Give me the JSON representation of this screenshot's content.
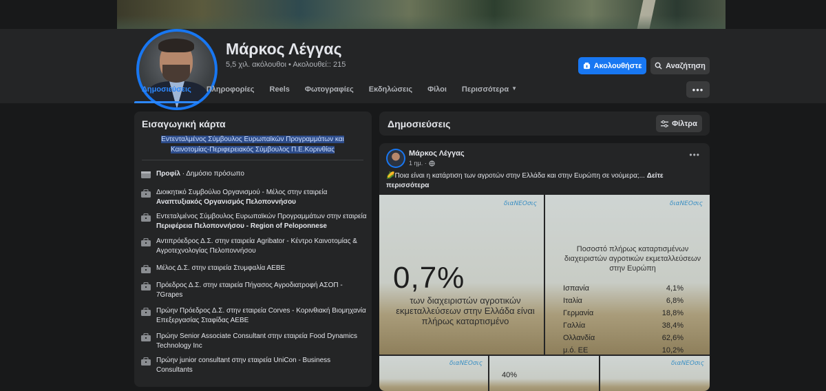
{
  "profile": {
    "name": "Μάρκος Λέγγας",
    "stats": "5,5 χιλ. ακόλουθοι • Ακολουθεί:: 215",
    "follow_label": "Ακολουθήστε",
    "search_label": "Αναζήτηση",
    "more_icon": "more-dots-icon"
  },
  "tabs": [
    {
      "label": "Δημοσιεύσεις",
      "active": true
    },
    {
      "label": "Πληροφορίες"
    },
    {
      "label": "Reels"
    },
    {
      "label": "Φωτογραφίες"
    },
    {
      "label": "Εκδηλώσεις"
    },
    {
      "label": "Φίλοι"
    },
    {
      "label": "Περισσότερα"
    }
  ],
  "intro": {
    "title": "Εισαγωγική κάρτα",
    "bio_line1": "Εντενταλμένος Σύμβουλος Ευρωπαϊκών Προγραμμάτων και",
    "bio_line2": "Καινοτομίας-Περιφερειακός Σύμβουλος Π.Ε.Κορινθίας",
    "items": [
      {
        "a": "",
        "b": "Προφίλ",
        "c": " · Δημόσιο πρόσωπο"
      },
      {
        "a": "Διοικητικό Συμβούλιο Οργανισμού - Μέλος στην εταιρεία ",
        "b": "Αναπτυξιακός Οργανισμός Πελοποννήσου",
        "c": ""
      },
      {
        "a": "Εντεταλμένος Σύμβουλος Ευρωπαϊκών Προγραμμάτων στην εταιρεία ",
        "b": "Περιφέρεια Πελοποννήσου - Region of Peloponnese",
        "c": ""
      },
      {
        "a": "Αντιπρόεδρος Δ.Σ. στην εταιρεία Agribator - Κέντρο Καινοτομίας & Αγροτεχνολογίας Πελοποννήσου",
        "b": "",
        "c": ""
      },
      {
        "a": "Μέλος Δ.Σ. στην εταιρεία Στυμφαλία ΑΕΒΕ",
        "b": "",
        "c": ""
      },
      {
        "a": "Πρόεδρος Δ.Σ. στην εταιρεία Πήγασος Αγροδιατροφή ΑΣΟΠ - 7Grapes",
        "b": "",
        "c": ""
      },
      {
        "a": "Πρώην Πρόεδρος Δ.Σ. στην εταιρεία Corves - Κορινθιακή Βιομηχανία Επεξεργασίας Σταφίδας ΑΕΒΕ",
        "b": "",
        "c": ""
      },
      {
        "a": "Πρώην Senior Associate Consultant στην εταιρεία Food Dynamics Technology Inc",
        "b": "",
        "c": ""
      },
      {
        "a": "Πρώην junior consultant στην εταιρεία UniCon - Business Consultants",
        "b": "",
        "c": ""
      }
    ]
  },
  "posts": {
    "title": "Δημοσιεύσεις",
    "filter_label": "Φίλτρα",
    "post": {
      "author": "Μάρκος Λέγγας",
      "time": "1 ημ. ·",
      "text": "🌽Ποια είναι η κατάρτιση των αγροτών στην Ελλάδα και στην Ευρώπη σε νούμερα;... ",
      "see_more": "Δείτε περισσότερα",
      "img1": {
        "logo": "διαΝΕΟσις",
        "big": "0,7%",
        "sub": "των διαχειριστών αγροτικών εκμεταλλεύσεων στην Ελλάδα είναι πλήρως καταρτισμένο"
      },
      "img2": {
        "logo": "διαΝΕΟσις",
        "title": "Ποσοστό πλήρως καταρτισμένων διαχειριστών αγροτικών εκμεταλλεύσεων στην Ευρώπη",
        "rows": [
          {
            "country": "Ισπανία",
            "value": "4,1%"
          },
          {
            "country": "Ιταλία",
            "value": "6,8%"
          },
          {
            "country": "Γερμανία",
            "value": "18,8%"
          },
          {
            "country": "Γαλλία",
            "value": "38,4%"
          },
          {
            "country": "Ολλανδία",
            "value": "62,6%"
          },
          {
            "country": "μ.ό. ΕΕ",
            "value": "10,2%"
          }
        ]
      },
      "img3": {
        "logo": "διαΝΕΟσις"
      },
      "img4": {
        "pct": "40%"
      },
      "img5": {
        "logo": "διαΝΕΟσις"
      }
    }
  },
  "colors": {
    "accent": "#1877f2",
    "tab_active": "#2d88ff",
    "bg": "#18191a",
    "card": "#242526"
  }
}
